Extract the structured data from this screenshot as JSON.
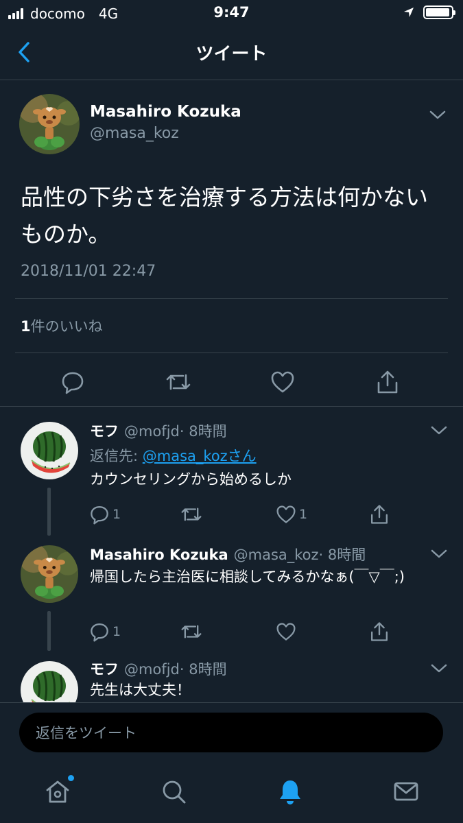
{
  "status_bar": {
    "carrier": "docomo",
    "network": "4G",
    "time": "9:47",
    "battery_level": 0.95
  },
  "nav": {
    "title": "ツイート"
  },
  "main_tweet": {
    "author_name": "Masahiro Kozuka",
    "author_handle": "@masa_koz",
    "text": "品性の下劣さを治療する方法は何かないものか。",
    "timestamp": "2018/11/01 22:47",
    "like_count": "1",
    "like_label": "件のいいね"
  },
  "replies": [
    {
      "author_name": "モフ",
      "author_handle": "@mofjd",
      "time": "· 8時間",
      "replying_prefix": "返信先: ",
      "replying_to": "@masa_kozさん",
      "text": "カウンセリングから始めるしか",
      "reply_count": "1",
      "retweet_count": "",
      "like_count": "1"
    },
    {
      "author_name": "Masahiro Kozuka",
      "author_handle": "@masa_koz",
      "time": "· 8時間",
      "text": "帰国したら主治医に相談してみるかなぁ(￣▽￣;)",
      "reply_count": "1",
      "retweet_count": "",
      "like_count": ""
    },
    {
      "author_name": "モフ",
      "author_handle": "@mofjd",
      "time": "· 8時間",
      "text": "先生は大丈夫！"
    }
  ],
  "composer": {
    "placeholder": "返信をツイート"
  },
  "tab_bar": {
    "items": [
      "home-icon",
      "search-icon",
      "notifications-icon",
      "messages-icon"
    ],
    "active": "notifications-icon",
    "home_has_badge": true
  },
  "colors": {
    "background": "#15202b",
    "accent": "#1da1f2",
    "muted": "#8899a6",
    "divider": "#38444d"
  }
}
